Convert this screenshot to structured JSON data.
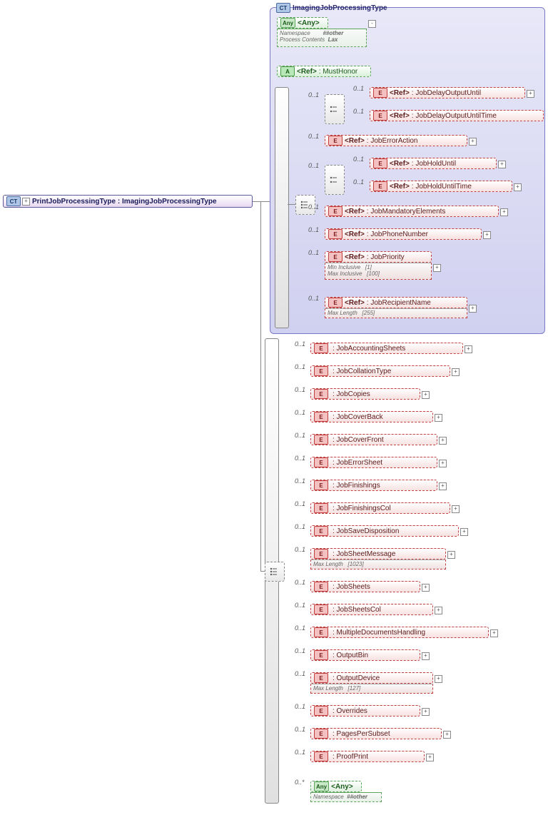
{
  "root": {
    "label": "PrintJobProcessingType : ImagingJobProcessingType"
  },
  "panel": {
    "title": "ImagingJobProcessingType"
  },
  "any1": {
    "label": "<Any>",
    "ns_k": "Namespace",
    "ns_v": "##other",
    "pc_k": "Process Contents",
    "pc_v": "Lax"
  },
  "attr": {
    "label": "<Ref>",
    "val": ": MustHonor"
  },
  "ref": "<Ref>",
  "any": "<Any>",
  "c": {
    "c01": "0..1",
    "cstar": "0..*"
  },
  "imaging": [
    {
      "n": "JobDelayOutputUntil"
    },
    {
      "n": "JobDelayOutputUntilTime"
    },
    {
      "n": "JobErrorAction"
    },
    {
      "n": "JobHoldUntil"
    },
    {
      "n": "JobHoldUntilTime"
    },
    {
      "n": "JobMandatoryElements"
    },
    {
      "n": "JobPhoneNumber"
    },
    {
      "n": "JobPriority",
      "m1k": "Min Inclusive",
      "m1v": "[1]",
      "m2k": "Max Inclusive",
      "m2v": "[100]"
    },
    {
      "n": "JobRecipientName",
      "mk": "Max Length",
      "mv": "[255]"
    }
  ],
  "print": [
    {
      "n": "JobAccountingSheets"
    },
    {
      "n": "JobCollationType"
    },
    {
      "n": "JobCopies"
    },
    {
      "n": "JobCoverBack"
    },
    {
      "n": "JobCoverFront"
    },
    {
      "n": "JobErrorSheet"
    },
    {
      "n": "JobFinishings"
    },
    {
      "n": "JobFinishingsCol"
    },
    {
      "n": "JobSaveDisposition"
    },
    {
      "n": "JobSheetMessage",
      "mk": "Max Length",
      "mv": "[1023]"
    },
    {
      "n": "JobSheets"
    },
    {
      "n": "JobSheetsCol"
    },
    {
      "n": "MultipleDocumentsHandling"
    },
    {
      "n": "OutputBin"
    },
    {
      "n": "OutputDevice",
      "mk": "Max Length",
      "mv": "[127]"
    },
    {
      "n": "Overrides"
    },
    {
      "n": "PagesPerSubset"
    },
    {
      "n": "ProofPrint"
    }
  ],
  "any2": {
    "ns_k": "Namespace",
    "ns_v": "##other"
  }
}
